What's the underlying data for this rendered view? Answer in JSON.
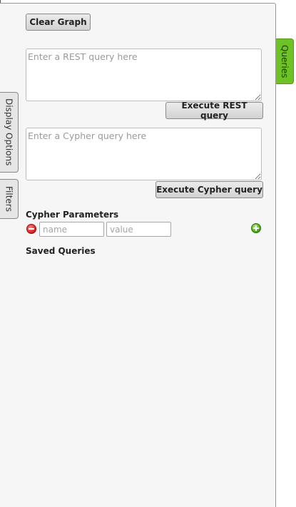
{
  "tabs": {
    "display_options": "Display Options",
    "filters": "Filters",
    "queries": "Queries"
  },
  "toolbar": {
    "clear_graph": "Clear Graph"
  },
  "rest": {
    "placeholder": "Enter a REST query here",
    "value": "",
    "execute_label": "Execute REST query"
  },
  "cypher": {
    "placeholder": "Enter a Cypher query here",
    "value": "",
    "execute_label": "Execute Cypher query"
  },
  "params": {
    "heading": "Cypher Parameters",
    "name_placeholder": "name",
    "value_placeholder": "value",
    "remove_icon": "minus-circle-icon",
    "add_icon": "plus-circle-icon"
  },
  "saved": {
    "heading": "Saved Queries",
    "items": []
  },
  "colors": {
    "queries_tab": "#6ec224",
    "remove": "#d11a1a",
    "add": "#3a9d12"
  }
}
